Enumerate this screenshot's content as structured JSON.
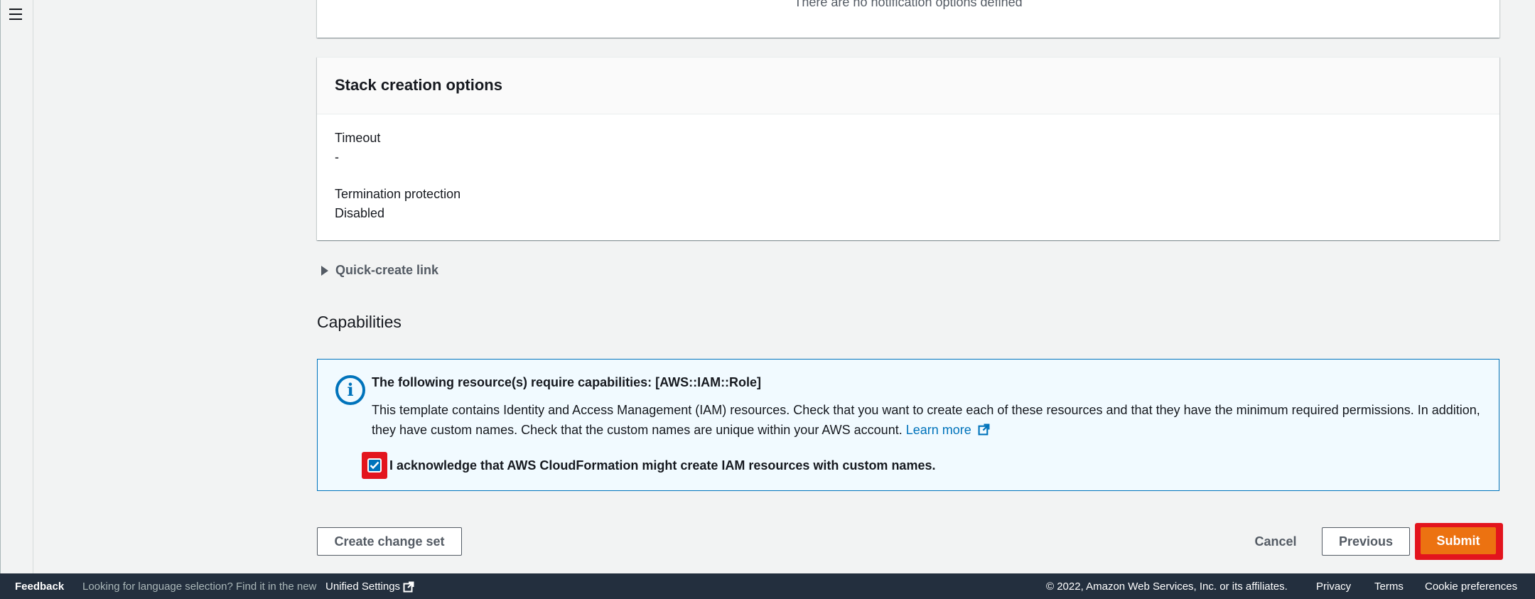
{
  "top_panel": {
    "faded_text": "There are no notification options defined"
  },
  "stack_options": {
    "title": "Stack creation options",
    "timeout_label": "Timeout",
    "timeout_value": "-",
    "termination_label": "Termination protection",
    "termination_value": "Disabled"
  },
  "quick_create": {
    "label": "Quick-create link"
  },
  "capabilities": {
    "title": "Capabilities",
    "alert_title": "The following resource(s) require capabilities: [AWS::IAM::Role]",
    "alert_body": "This template contains Identity and Access Management (IAM) resources. Check that you want to create each of these resources and that they have the minimum required permissions. In addition, they have custom names. Check that the custom names are unique within your AWS account.",
    "learn_more": "Learn more",
    "ack_label": "I acknowledge that AWS CloudFormation might create IAM resources with custom names.",
    "ack_checked": true
  },
  "actions": {
    "create_change_set": "Create change set",
    "cancel": "Cancel",
    "previous": "Previous",
    "submit": "Submit"
  },
  "footer": {
    "feedback": "Feedback",
    "lang_text": "Looking for language selection? Find it in the new",
    "unified_settings": "Unified Settings",
    "copyright": "© 2022, Amazon Web Services, Inc. or its affiliates.",
    "privacy": "Privacy",
    "terms": "Terms",
    "cookies": "Cookie preferences"
  },
  "colors": {
    "accent": "#0073bb",
    "primary": "#ec7211",
    "highlight": "#e3141d",
    "footer_bg": "#232f3e"
  }
}
